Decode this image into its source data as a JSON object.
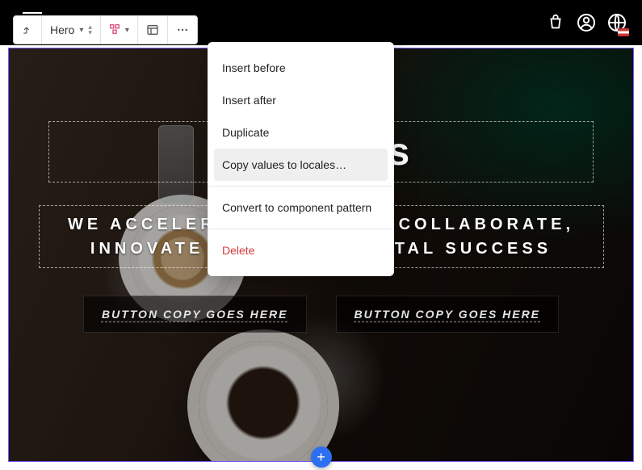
{
  "toolbar": {
    "component_label": "Hero"
  },
  "hero": {
    "title": "About Us",
    "subtitle": "WE ACCELERATE, PARTNER, COLLABORATE, INNOVATE AND DRIVE DIGITAL SUCCESS",
    "button1": "BUTTON COPY GOES HERE",
    "button2": "BUTTON COPY GOES HERE"
  },
  "menu": {
    "insert_before": "Insert before",
    "insert_after": "Insert after",
    "duplicate": "Duplicate",
    "copy_locales": "Copy values to locales…",
    "convert": "Convert to component pattern",
    "delete": "Delete"
  }
}
